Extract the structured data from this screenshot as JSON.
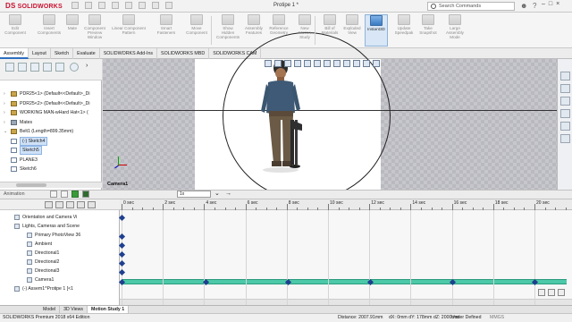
{
  "app": {
    "logo": "SOLIDWORKS",
    "logo_prefix": "DS",
    "document_title": "Protipe 1 *"
  },
  "search": {
    "placeholder": "Search Commands"
  },
  "ribbon": [
    {
      "label": "Edit\nComponent",
      "active": false
    },
    {
      "label": "Insert\nComponents",
      "active": false
    },
    {
      "label": "Mate",
      "active": false
    },
    {
      "label": "Component\nPreview\nWindow",
      "active": false
    },
    {
      "label": "Linear Component\nPattern",
      "active": false
    },
    {
      "label": "Smart\nFasteners",
      "active": false
    },
    {
      "label": "Move\nComponent",
      "active": false
    },
    {
      "label": "Show\nHidden\nComponents",
      "active": false
    },
    {
      "label": "Assembly\nFeatures",
      "active": false
    },
    {
      "label": "Reference\nGeometry",
      "active": false
    },
    {
      "label": "New\nMotion\nStudy",
      "active": false
    },
    {
      "label": "Bill of\nMaterials",
      "active": false
    },
    {
      "label": "Exploded\nView",
      "active": false
    },
    {
      "label": "Instant3D",
      "active": true
    },
    {
      "label": "Update\nSpeedpak",
      "active": false
    },
    {
      "label": "Take\nSnapshot",
      "active": false
    },
    {
      "label": "Large\nAssembly\nMode",
      "active": false
    }
  ],
  "tabs": [
    "Assembly",
    "Layout",
    "Sketch",
    "Evaluate",
    "SOLIDWORKS Add-Ins",
    "SOLIDWORKS MBD",
    "SOLIDWORKS CAM"
  ],
  "active_tab": "Assembly",
  "tree": [
    {
      "label": "PDR25<1> (Default<<Default>_Di",
      "exp": "›",
      "sel": false
    },
    {
      "label": "PDR25<2> (Default<<Default>_Di",
      "exp": "›",
      "sel": false
    },
    {
      "label": "WORKING MAN-wHard Hat<1> (",
      "exp": "›",
      "sel": false
    },
    {
      "label": "Mates",
      "exp": "›",
      "sel": false
    },
    {
      "label": "Belt1 (Length=899.35mm)",
      "exp": "⌄",
      "sel": false
    },
    {
      "label": "(-) Sketch4",
      "exp": "",
      "sel": true
    },
    {
      "label": "Sketch5",
      "exp": "",
      "sel": true
    },
    {
      "label": "PLANE3",
      "exp": "",
      "sel": false
    },
    {
      "label": "Sketch6",
      "exp": "",
      "sel": false
    }
  ],
  "viewport": {
    "camera_label": "Camera1"
  },
  "animation": {
    "label": "Animation",
    "speed": "1x"
  },
  "motion_tree": [
    {
      "label": "Orientation and Camera Vi",
      "indent": 1
    },
    {
      "label": "Lights, Cameras and Scene",
      "indent": 1
    },
    {
      "label": "Primary PhotoView 36",
      "indent": 2
    },
    {
      "label": "Ambient",
      "indent": 2
    },
    {
      "label": "Directional1",
      "indent": 2
    },
    {
      "label": "Directional2",
      "indent": 2
    },
    {
      "label": "Directional3",
      "indent": 2
    },
    {
      "label": "Camera1",
      "indent": 2
    },
    {
      "label": "(-) Assem1^Protipe 1 [<1",
      "indent": 1
    }
  ],
  "timeline": {
    "ticks": [
      "0 sec",
      "2 sec",
      "4 sec",
      "6 sec",
      "8 sec",
      "10 sec",
      "12 sec",
      "14 sec",
      "16 sec",
      "18 sec",
      "20 sec"
    ]
  },
  "bottom_tabs": [
    "Model",
    "3D Views",
    "Motion Study 1"
  ],
  "active_bottom_tab": "Motion Study 1",
  "status": {
    "left": "SOLIDWORKS Premium 2018 x64 Edition",
    "distance": "Distance: 2007.91mm",
    "deltas": "dX: 0mm  dY: 178mm  dZ: 2000mm",
    "units": "Under Defined",
    "mode": "MMGS"
  },
  "colors": {
    "accent": "#2f6fbf",
    "track": "#4cc9a8",
    "key": "#1f3f8f",
    "brand": "#c8102e"
  }
}
